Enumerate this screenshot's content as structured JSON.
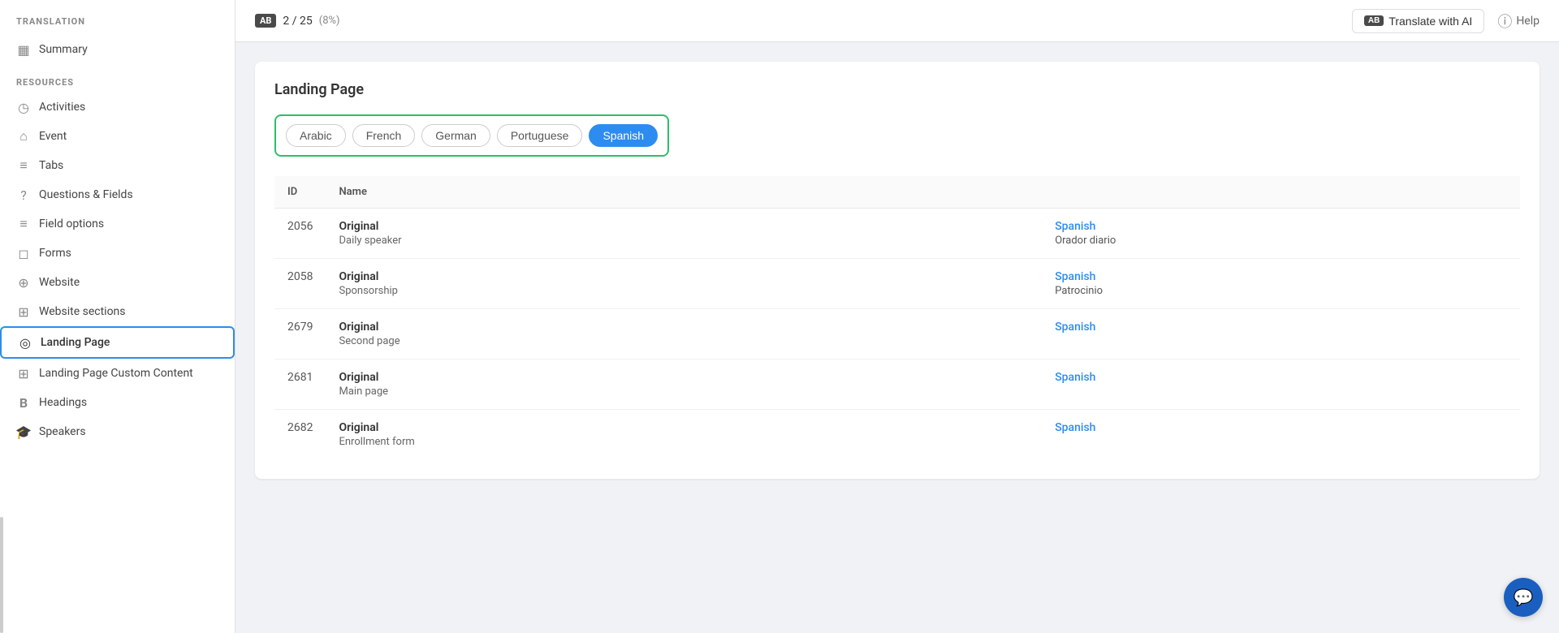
{
  "app": {
    "title": "TRANSLATION"
  },
  "header": {
    "badge": "AB",
    "count": "2 / 25",
    "pct": "(8%)",
    "translate_ai_label": "Translate with AI",
    "translate_ai_badge": "AB",
    "help_label": "Help"
  },
  "sidebar": {
    "section_resources": "RESOURCES",
    "items": [
      {
        "id": "summary",
        "label": "Summary",
        "icon": "▦",
        "active": false
      },
      {
        "id": "activities",
        "label": "Activities",
        "icon": "◷",
        "active": false
      },
      {
        "id": "event",
        "label": "Event",
        "icon": "⌂",
        "active": false
      },
      {
        "id": "tabs",
        "label": "Tabs",
        "icon": "≡",
        "active": false
      },
      {
        "id": "questions-fields",
        "label": "Questions & Fields",
        "icon": "?",
        "active": false
      },
      {
        "id": "field-options",
        "label": "Field options",
        "icon": "≡",
        "active": false
      },
      {
        "id": "forms",
        "label": "Forms",
        "icon": "◻",
        "active": false
      },
      {
        "id": "website",
        "label": "Website",
        "icon": "⊕",
        "active": false
      },
      {
        "id": "website-sections",
        "label": "Website sections",
        "icon": "⊞",
        "active": false
      },
      {
        "id": "landing-page",
        "label": "Landing Page",
        "icon": "◎",
        "active": true
      },
      {
        "id": "landing-page-custom",
        "label": "Landing Page Custom Content",
        "icon": "⊞",
        "active": false
      },
      {
        "id": "headings",
        "label": "Headings",
        "icon": "B",
        "active": false
      },
      {
        "id": "speakers",
        "label": "Speakers",
        "icon": "🎓",
        "active": false
      }
    ]
  },
  "card": {
    "title": "Landing Page"
  },
  "languages": [
    {
      "id": "arabic",
      "label": "Arabic",
      "active": false
    },
    {
      "id": "french",
      "label": "French",
      "active": false
    },
    {
      "id": "german",
      "label": "German",
      "active": false
    },
    {
      "id": "portuguese",
      "label": "Portuguese",
      "active": false
    },
    {
      "id": "spanish",
      "label": "Spanish",
      "active": true
    }
  ],
  "table": {
    "col_id": "ID",
    "col_name": "Name",
    "rows": [
      {
        "id": "2056",
        "original_label": "Original",
        "original_value": "Daily speaker",
        "translation_label": "Spanish",
        "translation_value": "Orador diario"
      },
      {
        "id": "2058",
        "original_label": "Original",
        "original_value": "Sponsorship",
        "translation_label": "Spanish",
        "translation_value": "Patrocinio"
      },
      {
        "id": "2679",
        "original_label": "Original",
        "original_value": "Second page",
        "translation_label": "Spanish",
        "translation_value": ""
      },
      {
        "id": "2681",
        "original_label": "Original",
        "original_value": "Main page",
        "translation_label": "Spanish",
        "translation_value": ""
      },
      {
        "id": "2682",
        "original_label": "Original",
        "original_value": "Enrollment form",
        "translation_label": "Spanish",
        "translation_value": ""
      }
    ]
  }
}
